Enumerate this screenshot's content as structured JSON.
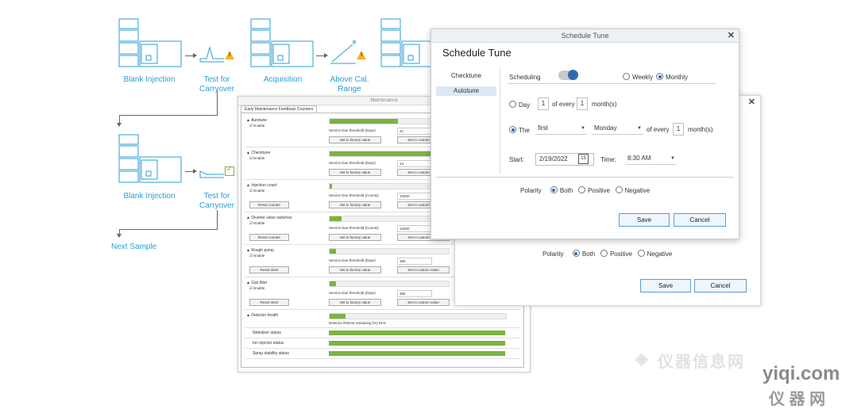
{
  "workflow": {
    "row1": [
      "Blank Injection",
      "Test for Carryover",
      "Acquisition",
      "Above Cal. Range"
    ],
    "row2": [
      "Blank Injection",
      "Test for Carryover"
    ],
    "next": "Next Sample"
  },
  "maintenance": {
    "title": "Maintenance",
    "tab": "Early Maintenance Feedback Counters",
    "enable": "Enable",
    "factory_btn": "Set to factory value",
    "custom_btn": "Set to custom value",
    "rows": [
      {
        "name": "Autotune",
        "threshold_label": "Service Due threshold (Days)",
        "threshold": "31",
        "progress": 0.6
      },
      {
        "name": "Checktune",
        "threshold_label": "Service Due threshold (Days)",
        "threshold": "14",
        "progress": 1.0
      },
      {
        "name": "Injection count",
        "threshold_label": "Service Due threshold (Counts)",
        "threshold": "10000",
        "reset": "Reset counter",
        "progress": 0.02
      },
      {
        "name": "Diverter valve switches",
        "threshold_label": "Service Due threshold (Counts)",
        "threshold": "10000",
        "reset": "Reset counter",
        "progress": 0.1
      },
      {
        "name": "Rough pump",
        "threshold_label": "Service Due threshold (Days)",
        "threshold": "365",
        "reset": "Reset timer",
        "progress": 0.05
      },
      {
        "name": "Gas filter",
        "threshold_label": "Service Due threshold (Days)",
        "threshold": "365",
        "reset": "Reset timer",
        "progress": 0.05
      }
    ],
    "detector": {
      "name": "Detector health",
      "remaining_label": "Detector lifetime remaining (%)",
      "remaining": "91%",
      "progress": 0.09
    },
    "statuses": [
      "Nebulizer status",
      "Ion injector status",
      "Spray stability status"
    ]
  },
  "schedule": {
    "window_title": "Schedule Tune",
    "heading": "Schedule Tune",
    "nav": [
      "Checktune",
      "Autotune"
    ],
    "scheduling_label": "Scheduling",
    "weekly": "Weekly",
    "monthly": "Monthly",
    "day_label": "Day",
    "day_value": "1",
    "of_every": "of every",
    "of_every_value": "1",
    "months": "month(s)",
    "the_label": "The",
    "ordinal": "first",
    "weekday": "Monday",
    "the_every_value": "1",
    "start_label": "Start:",
    "start_date": "2/19/2022",
    "time_label": "Time:",
    "time_value": "8:30 AM",
    "polarity": "Polarity",
    "both": "Both",
    "positive": "Positive",
    "negative": "Negative",
    "save": "Save",
    "cancel": "Cancel"
  },
  "watermark": {
    "site": "yiqi.com",
    "cn": "仪器信息网",
    "cn_short": "仪 器 网"
  },
  "colors": {
    "accent": "#2a9fd6",
    "progress": "#7cb342",
    "toggle": "#2b6cb0",
    "warning": "#f2b51e"
  }
}
